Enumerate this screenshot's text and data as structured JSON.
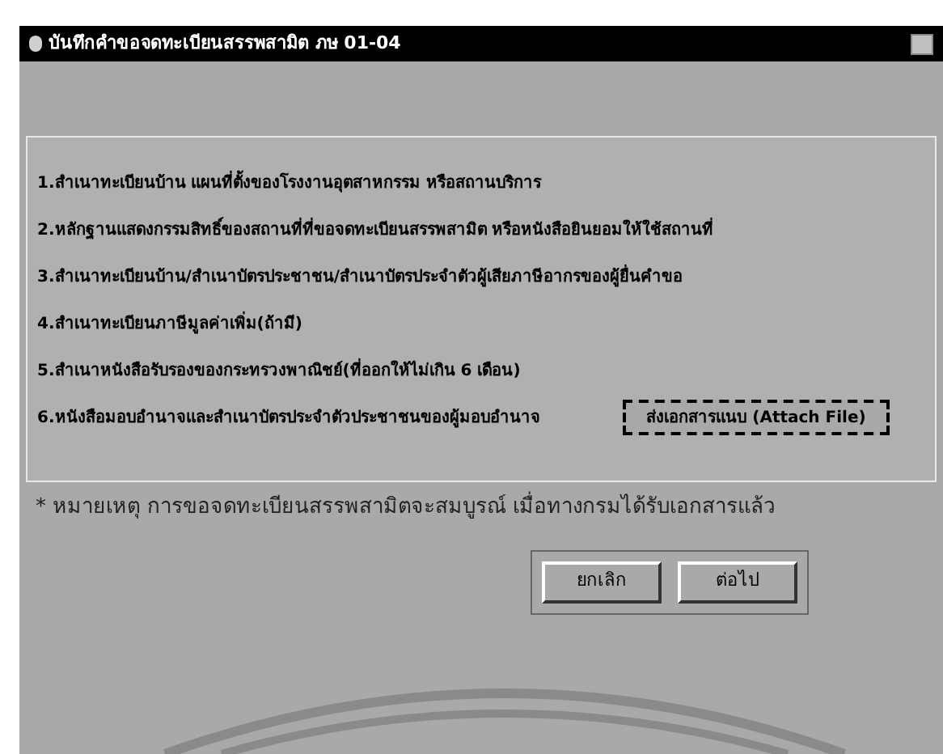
{
  "window": {
    "title": "บันทึกคำขอจดทะเบียนสรรพสามิต ภษ 01-04"
  },
  "documents": [
    {
      "label": "1.สำเนาทะเบียนบ้าน แผนที่ตั้งของโรงงานอุตสาหกรรม หรือสถานบริการ"
    },
    {
      "label": "2.หลักฐานแสดงกรรมสิทธิ์ของสถานที่ที่ขอจดทะเบียนสรรพสามิต หรือหนังสือยินยอมให้ใช้สถานที่"
    },
    {
      "label": "3.สำเนาทะเบียนบ้าน/สำเนาบัตรประชาชน/สำเนาบัตรประจำตัวผู้เสียภาษีอากรของผู้ยื่นคำขอ"
    },
    {
      "label": "4.สำเนาทะเบียนภาษีมูลค่าเพิ่ม(ถ้ามี)"
    },
    {
      "label": "5.สำเนาหนังสือรับรองของกระทรวงพาณิชย์(ที่ออกให้ไม่เกิน 6 เดือน)"
    },
    {
      "label": "6.หนังสือมอบอำนาจและสำเนาบัตรประจำตัวประชาชนของผู้มอบอำนาจ",
      "attach_button": "ส่งเอกสารแนบ (Attach File)"
    }
  ],
  "note": "* หมายเหตุ การขอจดทะเบียนสรรพสามิตจะสมบูรณ์ เมื่อทางกรมได้รับเอกสารแล้ว",
  "buttons": [
    "ยกเลิก",
    "ต่อไป"
  ]
}
